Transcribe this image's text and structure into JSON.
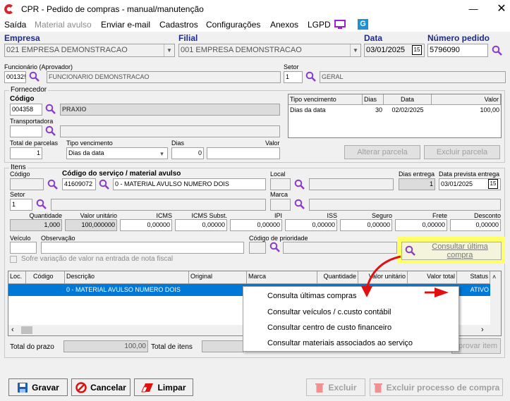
{
  "window": {
    "title": "CPR - Pedido de compras - manual/manutenção"
  },
  "menu": {
    "saida": "Saída",
    "material_avulso": "Material avulso",
    "enviar_email": "Enviar e-mail",
    "cadastros": "Cadastros",
    "configuracoes": "Configurações",
    "anexos": "Anexos",
    "lgpd": "LGPD"
  },
  "header": {
    "empresa_label": "Empresa",
    "empresa_value": "021 EMPRESA DEMONSTRACAO",
    "filial_label": "Filial",
    "filial_value": "001 EMPRESA DEMONSTRACAO",
    "data_label": "Data",
    "data_value": "03/01/2025",
    "cal_text": "15",
    "numero_label": "Número pedido",
    "numero_value": "5796090",
    "funcionario_label": "Funcionário (Aprovador)",
    "funcionario_code": "00132!",
    "funcionario_name": "FUNCIONARIO DEMONSTRACAO",
    "setor_label": "Setor",
    "setor_code": "1",
    "setor_name": "GERAL"
  },
  "fornecedor": {
    "group_label": "Fornecedor",
    "codigo_label": "Código",
    "codigo_value": "004358",
    "nome_value": "PRAXIO",
    "transportadora_label": "Transportadora",
    "total_parcelas_label": "Total de parcelas",
    "total_parcelas_value": "1",
    "tipo_venc_label": "Tipo vencimento",
    "tipo_venc_value": "Dias da data",
    "dias_label": "Dias",
    "dias_value": "0",
    "valor_label": "Valor",
    "grid": {
      "headers": [
        "Tipo vencimento",
        "Dias",
        "Data",
        "Valor"
      ],
      "row": [
        "Dias da data",
        "30",
        "02/02/2025",
        "100,00"
      ]
    },
    "alterar_parcela": "Alterar parcela",
    "excluir_parcela": "Excluir parcela"
  },
  "itens": {
    "group_label": "Itens",
    "codigo_label": "Código",
    "servico_label": "Código do serviço / material avulso",
    "servico_code": "41609072",
    "servico_desc": "0 - MATERIAL AVULSO NUMERO DOIS",
    "local_label": "Local",
    "dias_entrega_label": "Dias entrega",
    "dias_entrega_value": "1",
    "data_prevista_label": "Data prevista entrega",
    "data_prevista_value": "03/01/2025",
    "setor_label": "Setor",
    "setor_code": "1",
    "marca_label": "Marca",
    "quantidade_label": "Quantidade",
    "quantidade_value": "1,000",
    "valor_unit_label": "Valor unitário",
    "valor_unit_value": "100,000000",
    "icms_label": "ICMS",
    "icms_value": "0,00000",
    "icms_subst_label": "ICMS Subst.",
    "icms_subst_value": "0,00000",
    "ipi_label": "IPI",
    "ipi_value": "0,00000",
    "iss_label": "ISS",
    "iss_value": "0,00000",
    "seguro_label": "Seguro",
    "seguro_value": "0,00000",
    "frete_label": "Frete",
    "frete_value": "0,00000",
    "desconto_label": "Desconto",
    "desconto_value": "0,00000",
    "veiculo_label": "Veículo",
    "observacao_label": "Observação",
    "prioridade_label": "Código de prioridade",
    "consultar_btn": "Consultar última compra",
    "sofre_variacao": "Sofre variação de valor na entrada de nota fiscal"
  },
  "items_grid": {
    "headers": [
      "Loc.",
      "Código",
      "Descrição",
      "Original",
      "Marca",
      "Quantidade",
      "Valor unitário",
      "Valor total",
      "Status"
    ],
    "row": {
      "descricao": "0 - MATERIAL AVULSO NUMERO DOIS",
      "status": "ATIVO"
    }
  },
  "context_menu": {
    "items": [
      "Consulta últimas compras",
      "Consultar veículos / c.custo contábil",
      "Consultar centro de custo financeiro",
      "Consultar materiais associados ao serviço"
    ]
  },
  "totals": {
    "total_prazo_label": "Total do prazo",
    "total_prazo_value": "100,00",
    "total_itens_label": "Total de itens",
    "aprovar_item": "Aprovar item"
  },
  "buttons": {
    "gravar": "Gravar",
    "cancelar": "Cancelar",
    "limpar": "Limpar",
    "excluir": "Excluir",
    "excluir_processo": "Excluir processo de compra"
  },
  "colors": {
    "label_blue": "#1f2b8a",
    "selection": "#0078d7",
    "highlight": "#ffff66",
    "arrow": "#e01010"
  }
}
